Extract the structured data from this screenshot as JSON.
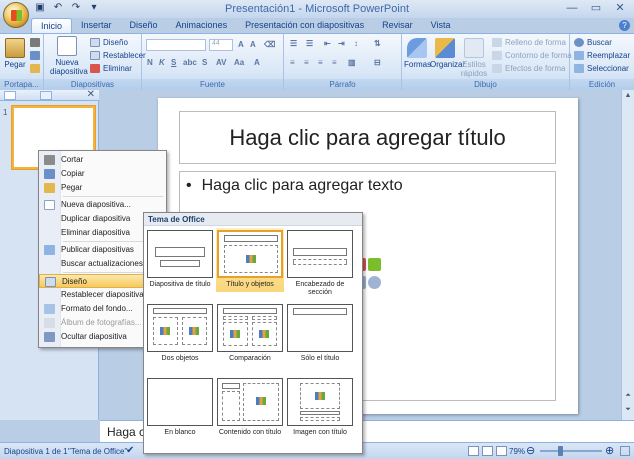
{
  "window": {
    "title": "Presentación1 - Microsoft PowerPoint"
  },
  "tabs": [
    "Inicio",
    "Insertar",
    "Diseño",
    "Animaciones",
    "Presentación con diapositivas",
    "Revisar",
    "Vista"
  ],
  "ribbon": {
    "clipboard": {
      "label": "Portapa...",
      "paste": "Pegar"
    },
    "slides": {
      "label": "Diapositivas",
      "new_slide": "Nueva diapositiva",
      "layout": "Diseño",
      "reset": "Restablecer",
      "delete": "Eliminar"
    },
    "font": {
      "label": "Fuente",
      "size_placeholder": "44"
    },
    "paragraph": {
      "label": "Párrafo"
    },
    "drawing": {
      "label": "Dibujo",
      "shapes": "Formas",
      "arrange": "Organizar",
      "quick_styles": "Estilos rápidos",
      "fill": "Relleno de forma",
      "outline": "Contorno de forma",
      "effects": "Efectos de forma"
    },
    "editing": {
      "label": "Edición",
      "find": "Buscar",
      "replace": "Reemplazar",
      "select": "Seleccionar"
    }
  },
  "slide_panel": {
    "slide_number": "1"
  },
  "slide": {
    "title_placeholder": "Haga clic para agregar título",
    "body_placeholder": "Haga clic para agregar texto"
  },
  "notes": {
    "placeholder": "Haga clic"
  },
  "context_menu": {
    "items": [
      "Cortar",
      "Copiar",
      "Pegar",
      "Nueva diapositiva...",
      "Duplicar diapositiva",
      "Eliminar diapositiva",
      "Publicar diapositivas",
      "Buscar actualizaciones",
      "Diseño",
      "Restablecer diapositiva",
      "Formato del fondo...",
      "Álbum de fotografías...",
      "Ocultar diapositiva"
    ]
  },
  "layout_gallery": {
    "header": "Tema de Office",
    "layouts": [
      "Diapositiva de título",
      "Título y objetos",
      "Encabezado de sección",
      "Dos objetos",
      "Comparación",
      "Sólo el título",
      "En blanco",
      "Contenido con título",
      "Imagen con título"
    ]
  },
  "status": {
    "slide_info": "Diapositiva 1 de 1",
    "theme": "\"Tema de Office\"",
    "zoom": "79%"
  },
  "colors": {
    "accent": "#15428b",
    "highlight": "#f7c85b",
    "background": "#b9cde5"
  }
}
